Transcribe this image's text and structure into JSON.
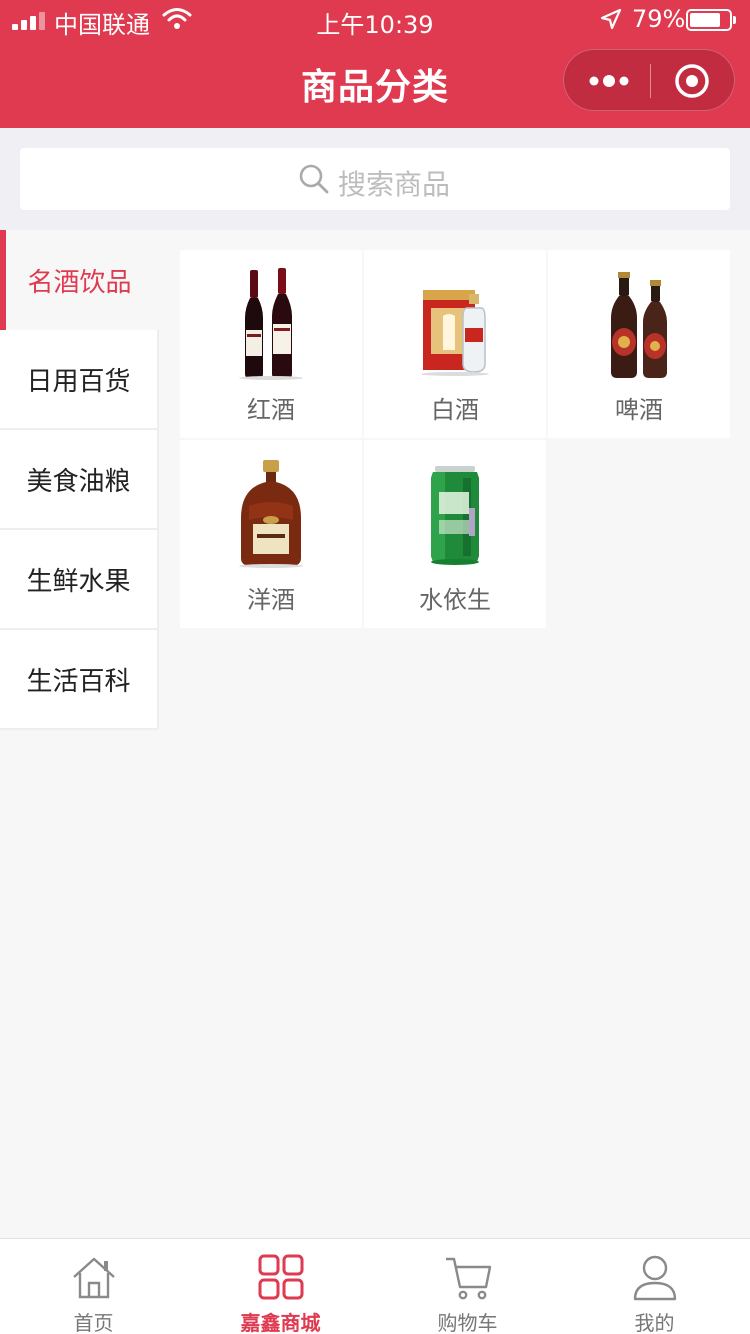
{
  "colors": {
    "brand": "#df3a50",
    "background": "#f7f7f7",
    "tab_inactive": "#777777"
  },
  "status_bar": {
    "carrier": "中国联通",
    "time": "上午10:39",
    "battery_text": "79%",
    "battery_level": 0.79
  },
  "nav": {
    "title": "商品分类",
    "more_icon": "more-dots-icon",
    "close_icon": "target-circle-icon"
  },
  "search": {
    "placeholder": "搜索商品",
    "icon": "search-icon"
  },
  "sidebar": {
    "items": [
      {
        "label": "名酒饮品",
        "active": true
      },
      {
        "label": "日用百货",
        "active": false
      },
      {
        "label": "美食油粮",
        "active": false
      },
      {
        "label": "生鲜水果",
        "active": false
      },
      {
        "label": "生活百科",
        "active": false
      }
    ]
  },
  "products": [
    {
      "name": "红酒",
      "icon": "red-wine-bottles-image"
    },
    {
      "name": "白酒",
      "icon": "baijiu-gift-box-image"
    },
    {
      "name": "啤酒",
      "icon": "beer-bottles-image"
    },
    {
      "name": "洋酒",
      "icon": "cognac-bottle-image"
    },
    {
      "name": "水依生",
      "icon": "green-can-image"
    }
  ],
  "tabbar": {
    "items": [
      {
        "label": "首页",
        "icon": "home-icon",
        "active": false
      },
      {
        "label": "嘉鑫商城",
        "icon": "grid-icon",
        "active": true
      },
      {
        "label": "购物车",
        "icon": "cart-icon",
        "active": false
      },
      {
        "label": "我的",
        "icon": "user-icon",
        "active": false
      }
    ]
  }
}
